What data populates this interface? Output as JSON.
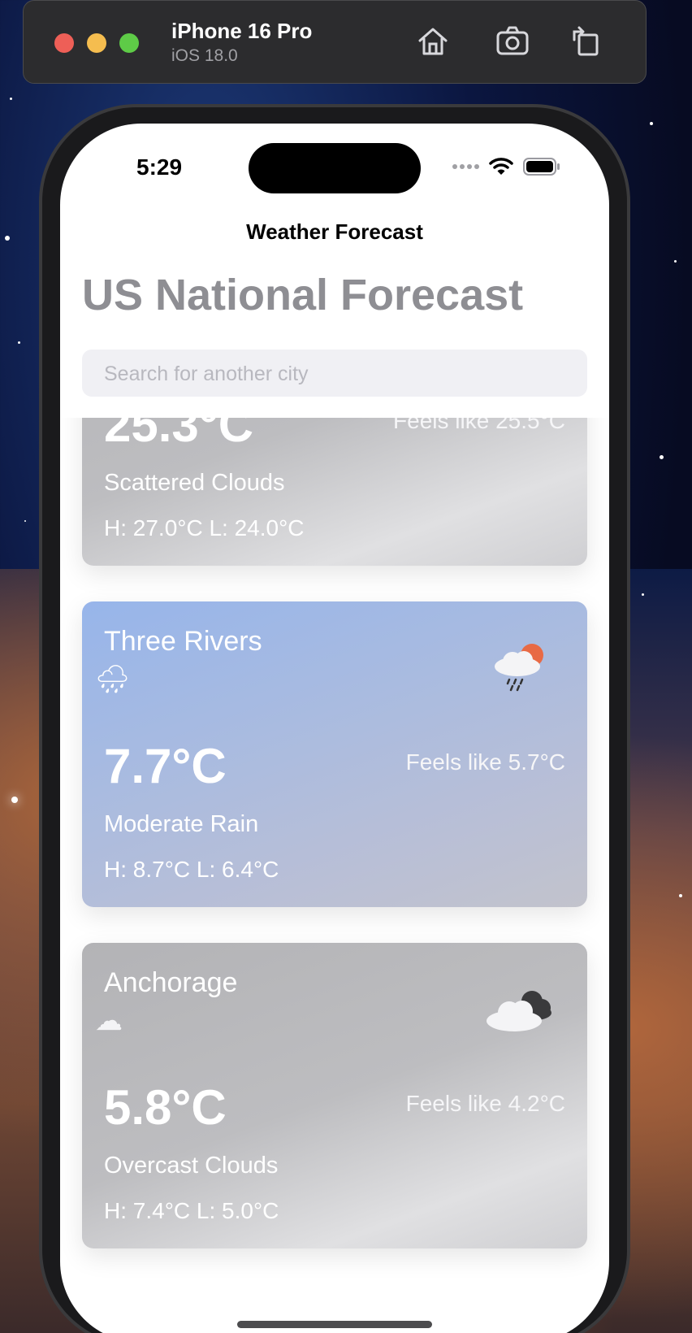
{
  "simulator": {
    "device_name": "iPhone 16 Pro",
    "os_version": "iOS 18.0"
  },
  "status_bar": {
    "time": "5:29"
  },
  "nav": {
    "title": "Weather Forecast",
    "large_title": "US National Forecast"
  },
  "search": {
    "placeholder": "Search for another city"
  },
  "cards": [
    {
      "city": "",
      "temp": "25.3°C",
      "feels_like": "Feels like 25.5°C",
      "description": "Scattered Clouds",
      "high_low": "H: 27.0°C  L: 24.0°C",
      "icon": "scattered-clouds-icon",
      "theme": "gray"
    },
    {
      "city": "Three Rivers",
      "temp": "7.7°C",
      "feels_like": "Feels like 5.7°C",
      "description": "Moderate Rain",
      "high_low": "H: 8.7°C  L: 6.4°C",
      "small_icon": "🌧",
      "icon": "rain-sun-cloud-icon",
      "theme": "blue"
    },
    {
      "city": "Anchorage",
      "temp": "5.8°C",
      "feels_like": "Feels like 4.2°C",
      "description": "Overcast Clouds",
      "high_low": "H: 7.4°C  L: 5.0°C",
      "small_icon": "☁",
      "icon": "overcast-clouds-icon",
      "theme": "gray"
    }
  ]
}
